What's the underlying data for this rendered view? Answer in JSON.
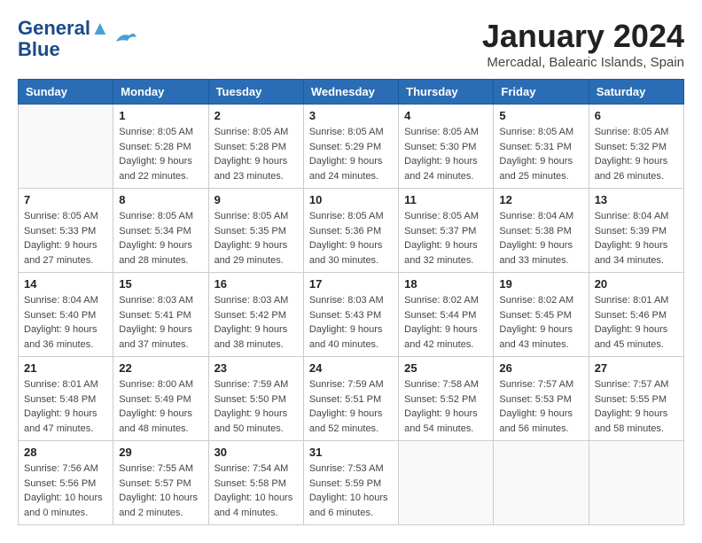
{
  "header": {
    "logo_line1": "General",
    "logo_line2": "Blue",
    "title": "January 2024",
    "location": "Mercadal, Balearic Islands, Spain"
  },
  "weekdays": [
    "Sunday",
    "Monday",
    "Tuesday",
    "Wednesday",
    "Thursday",
    "Friday",
    "Saturday"
  ],
  "weeks": [
    [
      {
        "day": "",
        "empty": true
      },
      {
        "day": "1",
        "sunrise": "Sunrise: 8:05 AM",
        "sunset": "Sunset: 5:28 PM",
        "daylight": "Daylight: 9 hours and 22 minutes."
      },
      {
        "day": "2",
        "sunrise": "Sunrise: 8:05 AM",
        "sunset": "Sunset: 5:28 PM",
        "daylight": "Daylight: 9 hours and 23 minutes."
      },
      {
        "day": "3",
        "sunrise": "Sunrise: 8:05 AM",
        "sunset": "Sunset: 5:29 PM",
        "daylight": "Daylight: 9 hours and 24 minutes."
      },
      {
        "day": "4",
        "sunrise": "Sunrise: 8:05 AM",
        "sunset": "Sunset: 5:30 PM",
        "daylight": "Daylight: 9 hours and 24 minutes."
      },
      {
        "day": "5",
        "sunrise": "Sunrise: 8:05 AM",
        "sunset": "Sunset: 5:31 PM",
        "daylight": "Daylight: 9 hours and 25 minutes."
      },
      {
        "day": "6",
        "sunrise": "Sunrise: 8:05 AM",
        "sunset": "Sunset: 5:32 PM",
        "daylight": "Daylight: 9 hours and 26 minutes."
      }
    ],
    [
      {
        "day": "7",
        "sunrise": "Sunrise: 8:05 AM",
        "sunset": "Sunset: 5:33 PM",
        "daylight": "Daylight: 9 hours and 27 minutes."
      },
      {
        "day": "8",
        "sunrise": "Sunrise: 8:05 AM",
        "sunset": "Sunset: 5:34 PM",
        "daylight": "Daylight: 9 hours and 28 minutes."
      },
      {
        "day": "9",
        "sunrise": "Sunrise: 8:05 AM",
        "sunset": "Sunset: 5:35 PM",
        "daylight": "Daylight: 9 hours and 29 minutes."
      },
      {
        "day": "10",
        "sunrise": "Sunrise: 8:05 AM",
        "sunset": "Sunset: 5:36 PM",
        "daylight": "Daylight: 9 hours and 30 minutes."
      },
      {
        "day": "11",
        "sunrise": "Sunrise: 8:05 AM",
        "sunset": "Sunset: 5:37 PM",
        "daylight": "Daylight: 9 hours and 32 minutes."
      },
      {
        "day": "12",
        "sunrise": "Sunrise: 8:04 AM",
        "sunset": "Sunset: 5:38 PM",
        "daylight": "Daylight: 9 hours and 33 minutes."
      },
      {
        "day": "13",
        "sunrise": "Sunrise: 8:04 AM",
        "sunset": "Sunset: 5:39 PM",
        "daylight": "Daylight: 9 hours and 34 minutes."
      }
    ],
    [
      {
        "day": "14",
        "sunrise": "Sunrise: 8:04 AM",
        "sunset": "Sunset: 5:40 PM",
        "daylight": "Daylight: 9 hours and 36 minutes."
      },
      {
        "day": "15",
        "sunrise": "Sunrise: 8:03 AM",
        "sunset": "Sunset: 5:41 PM",
        "daylight": "Daylight: 9 hours and 37 minutes."
      },
      {
        "day": "16",
        "sunrise": "Sunrise: 8:03 AM",
        "sunset": "Sunset: 5:42 PM",
        "daylight": "Daylight: 9 hours and 38 minutes."
      },
      {
        "day": "17",
        "sunrise": "Sunrise: 8:03 AM",
        "sunset": "Sunset: 5:43 PM",
        "daylight": "Daylight: 9 hours and 40 minutes."
      },
      {
        "day": "18",
        "sunrise": "Sunrise: 8:02 AM",
        "sunset": "Sunset: 5:44 PM",
        "daylight": "Daylight: 9 hours and 42 minutes."
      },
      {
        "day": "19",
        "sunrise": "Sunrise: 8:02 AM",
        "sunset": "Sunset: 5:45 PM",
        "daylight": "Daylight: 9 hours and 43 minutes."
      },
      {
        "day": "20",
        "sunrise": "Sunrise: 8:01 AM",
        "sunset": "Sunset: 5:46 PM",
        "daylight": "Daylight: 9 hours and 45 minutes."
      }
    ],
    [
      {
        "day": "21",
        "sunrise": "Sunrise: 8:01 AM",
        "sunset": "Sunset: 5:48 PM",
        "daylight": "Daylight: 9 hours and 47 minutes."
      },
      {
        "day": "22",
        "sunrise": "Sunrise: 8:00 AM",
        "sunset": "Sunset: 5:49 PM",
        "daylight": "Daylight: 9 hours and 48 minutes."
      },
      {
        "day": "23",
        "sunrise": "Sunrise: 7:59 AM",
        "sunset": "Sunset: 5:50 PM",
        "daylight": "Daylight: 9 hours and 50 minutes."
      },
      {
        "day": "24",
        "sunrise": "Sunrise: 7:59 AM",
        "sunset": "Sunset: 5:51 PM",
        "daylight": "Daylight: 9 hours and 52 minutes."
      },
      {
        "day": "25",
        "sunrise": "Sunrise: 7:58 AM",
        "sunset": "Sunset: 5:52 PM",
        "daylight": "Daylight: 9 hours and 54 minutes."
      },
      {
        "day": "26",
        "sunrise": "Sunrise: 7:57 AM",
        "sunset": "Sunset: 5:53 PM",
        "daylight": "Daylight: 9 hours and 56 minutes."
      },
      {
        "day": "27",
        "sunrise": "Sunrise: 7:57 AM",
        "sunset": "Sunset: 5:55 PM",
        "daylight": "Daylight: 9 hours and 58 minutes."
      }
    ],
    [
      {
        "day": "28",
        "sunrise": "Sunrise: 7:56 AM",
        "sunset": "Sunset: 5:56 PM",
        "daylight": "Daylight: 10 hours and 0 minutes."
      },
      {
        "day": "29",
        "sunrise": "Sunrise: 7:55 AM",
        "sunset": "Sunset: 5:57 PM",
        "daylight": "Daylight: 10 hours and 2 minutes."
      },
      {
        "day": "30",
        "sunrise": "Sunrise: 7:54 AM",
        "sunset": "Sunset: 5:58 PM",
        "daylight": "Daylight: 10 hours and 4 minutes."
      },
      {
        "day": "31",
        "sunrise": "Sunrise: 7:53 AM",
        "sunset": "Sunset: 5:59 PM",
        "daylight": "Daylight: 10 hours and 6 minutes."
      },
      {
        "day": "",
        "empty": true
      },
      {
        "day": "",
        "empty": true
      },
      {
        "day": "",
        "empty": true
      }
    ]
  ]
}
